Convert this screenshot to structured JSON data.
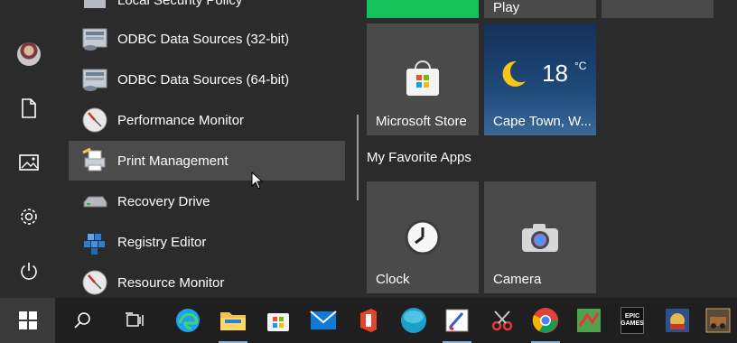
{
  "rail": {
    "items": [
      "user-account",
      "documents",
      "pictures",
      "settings",
      "power"
    ]
  },
  "applist": {
    "items": [
      {
        "label": "Local Security Policy"
      },
      {
        "label": "ODBC Data Sources (32-bit)"
      },
      {
        "label": "ODBC Data Sources (64-bit)"
      },
      {
        "label": "Performance Monitor"
      },
      {
        "label": "Print Management"
      },
      {
        "label": "Recovery Drive"
      },
      {
        "label": "Registry Editor"
      },
      {
        "label": "Resource Monitor"
      }
    ]
  },
  "tiles": {
    "top_partial_play": "Play",
    "store": "Microsoft Store",
    "weather_temp": "18",
    "weather_unit": "°C",
    "weather_location": "Cape Town, W...",
    "group_title": "My Favorite Apps",
    "clock": "Clock",
    "camera": "Camera"
  },
  "taskbar": {
    "apps": [
      "start",
      "search",
      "task-view",
      "edge",
      "file-explorer",
      "microsoft-store",
      "mail",
      "office",
      "unknown-teal",
      "paint",
      "snipping-tool",
      "chrome",
      "game",
      "epic-games",
      "game-2",
      "game-3"
    ],
    "epic_text": "EPIC GAMES"
  },
  "colors": {
    "accent_green": "#16c25c",
    "tile_gray": "#4a4a4a",
    "weather_blue": "#1e4a7a",
    "taskbar_underline": "#7fb0de"
  }
}
